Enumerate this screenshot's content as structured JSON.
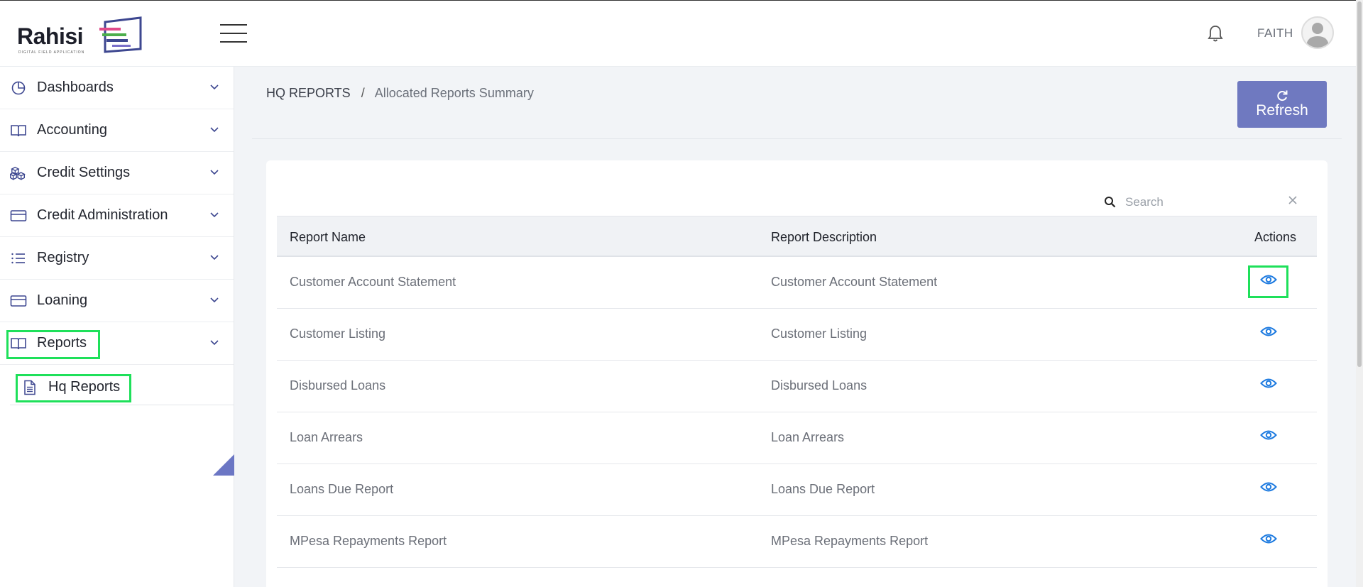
{
  "app": {
    "logo_text": "Rahisi",
    "logo_sub": "DIGITAL FIELD APPLICATION",
    "user_name": "FAITH"
  },
  "sidebar": {
    "items": [
      {
        "label": "Dashboards",
        "icon": "pie-chart-icon"
      },
      {
        "label": "Accounting",
        "icon": "book-open-icon"
      },
      {
        "label": "Credit Settings",
        "icon": "boxes-icon"
      },
      {
        "label": "Credit Administration",
        "icon": "credit-card-icon"
      },
      {
        "label": "Registry",
        "icon": "list-icon"
      },
      {
        "label": "Loaning",
        "icon": "credit-card-icon"
      },
      {
        "label": "Reports",
        "icon": "book-open-icon"
      }
    ],
    "sub_item": {
      "label": "Hq Reports",
      "icon": "document-icon"
    }
  },
  "breadcrumb": {
    "section": "HQ REPORTS",
    "separator": "/",
    "current": "Allocated Reports Summary"
  },
  "toolbar": {
    "refresh_label": "Refresh"
  },
  "search": {
    "placeholder": "Search",
    "value": ""
  },
  "table": {
    "headers": {
      "name": "Report Name",
      "description": "Report Description",
      "actions": "Actions"
    },
    "rows": [
      {
        "name": "Customer Account Statement",
        "description": "Customer Account Statement"
      },
      {
        "name": "Customer Listing",
        "description": "Customer Listing"
      },
      {
        "name": "Disbursed Loans",
        "description": "Disbursed Loans"
      },
      {
        "name": "Loan Arrears",
        "description": "Loan Arrears"
      },
      {
        "name": "Loans Due Report",
        "description": "Loans Due Report"
      },
      {
        "name": "MPesa Repayments Report",
        "description": "MPesa Repayments Report"
      }
    ]
  },
  "colors": {
    "accent": "#6f79c0",
    "highlight": "#1ee05a",
    "eye_icon": "#1e7be0"
  }
}
